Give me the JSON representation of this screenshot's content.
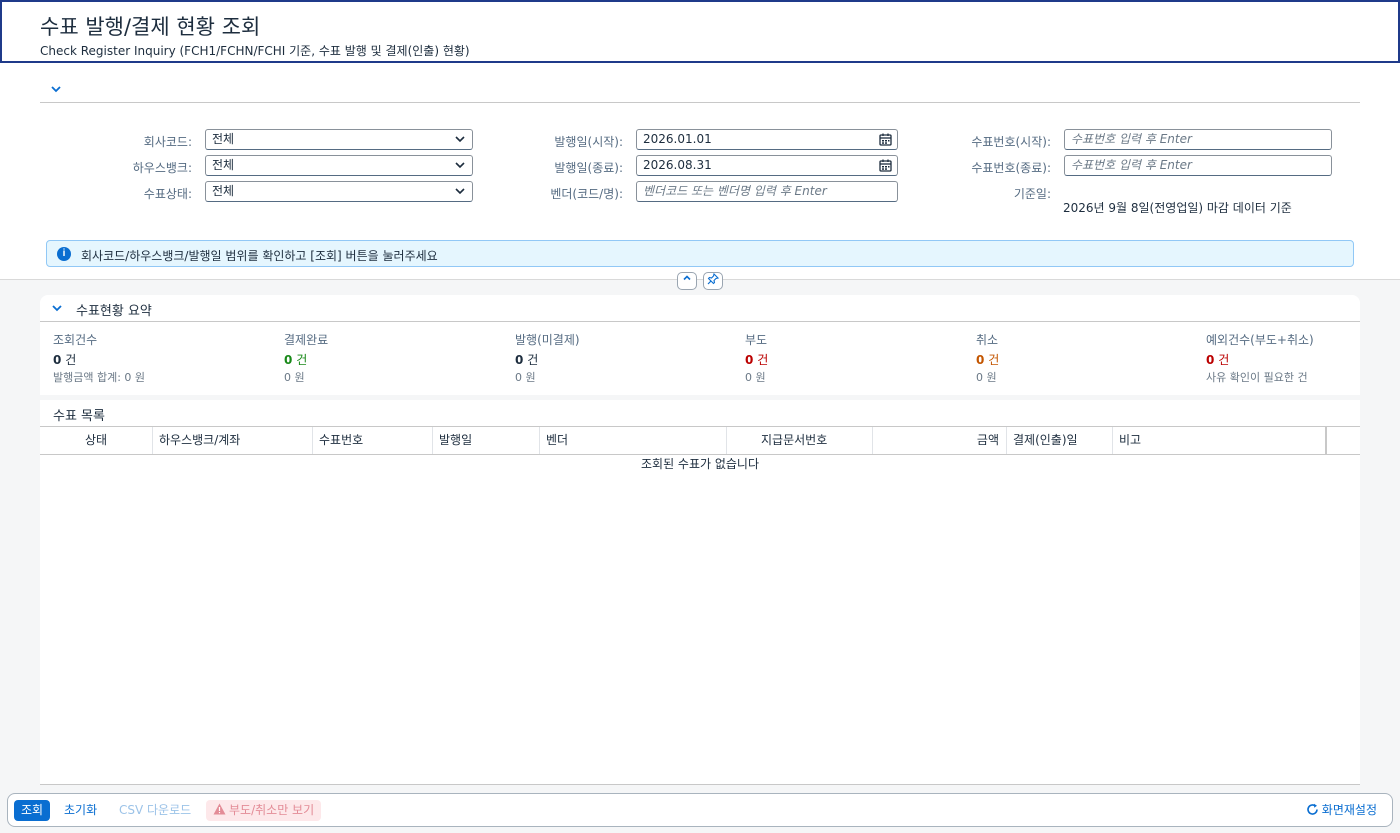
{
  "header": {
    "title": "수표 발행/결제 현황 조회",
    "subtitle": "Check Register Inquiry (FCH1/FCHN/FCHI 기준, 수표 발행 및 결제(인출) 현황)"
  },
  "filters": {
    "company_code": {
      "label": "회사코드:",
      "value": "전체"
    },
    "house_bank": {
      "label": "하우스뱅크:",
      "value": "전체"
    },
    "check_status": {
      "label": "수표상태:",
      "value": "전체"
    },
    "issue_date_from": {
      "label": "발행일(시작):",
      "value": "2026.01.01"
    },
    "issue_date_to": {
      "label": "발행일(종료):",
      "value": "2026.08.31"
    },
    "vendor": {
      "label": "벤더(코드/명):",
      "placeholder": "벤더코드 또는 벤더명 입력 후 Enter"
    },
    "check_no_from": {
      "label": "수표번호(시작):",
      "placeholder": "수표번호 입력 후 Enter"
    },
    "check_no_to": {
      "label": "수표번호(종료):",
      "placeholder": "수표번호 입력 후 Enter"
    },
    "ref_date": {
      "label": "기준일:",
      "value": "2026년 9월 8일(전영업일) 마감 데이터 기준"
    }
  },
  "info_message": "회사코드/하우스뱅크/발행일 범위를 확인하고 [조회] 버튼을 눌러주세요",
  "summary": {
    "title": "수표현황 요약",
    "kpis": [
      {
        "label": "조회건수",
        "count": "0",
        "unit": "건",
        "sub": "발행금액 합계: 0 원",
        "color": "#1d2d3e"
      },
      {
        "label": "결제완료",
        "count": "0",
        "unit": "건",
        "sub": "0 원",
        "color": "#188918"
      },
      {
        "label": "발행(미결제)",
        "count": "0",
        "unit": "건",
        "sub": "0 원",
        "color": "#1d2d3e"
      },
      {
        "label": "부도",
        "count": "0",
        "unit": "건",
        "sub": "0 원",
        "color": "#bb0000"
      },
      {
        "label": "취소",
        "count": "0",
        "unit": "건",
        "sub": "0 원",
        "color": "#c35500"
      },
      {
        "label": "예외건수(부도+취소)",
        "count": "0",
        "unit": "건",
        "sub": "사유 확인이 필요한 건",
        "color": "#bb0000"
      }
    ]
  },
  "list": {
    "title": "수표 목록",
    "columns": [
      "상태",
      "하우스뱅크/계좌",
      "수표번호",
      "발행일",
      "벤더",
      "지급문서번호",
      "금액",
      "결제(인출)일",
      "비고"
    ],
    "empty_text": "조회된 수표가 없습니다"
  },
  "footer": {
    "search": "조회",
    "reset": "초기화",
    "csv": "CSV 다운로드",
    "exceptions_only": "부도/취소만 보기",
    "reset_layout": "화면재설정"
  }
}
